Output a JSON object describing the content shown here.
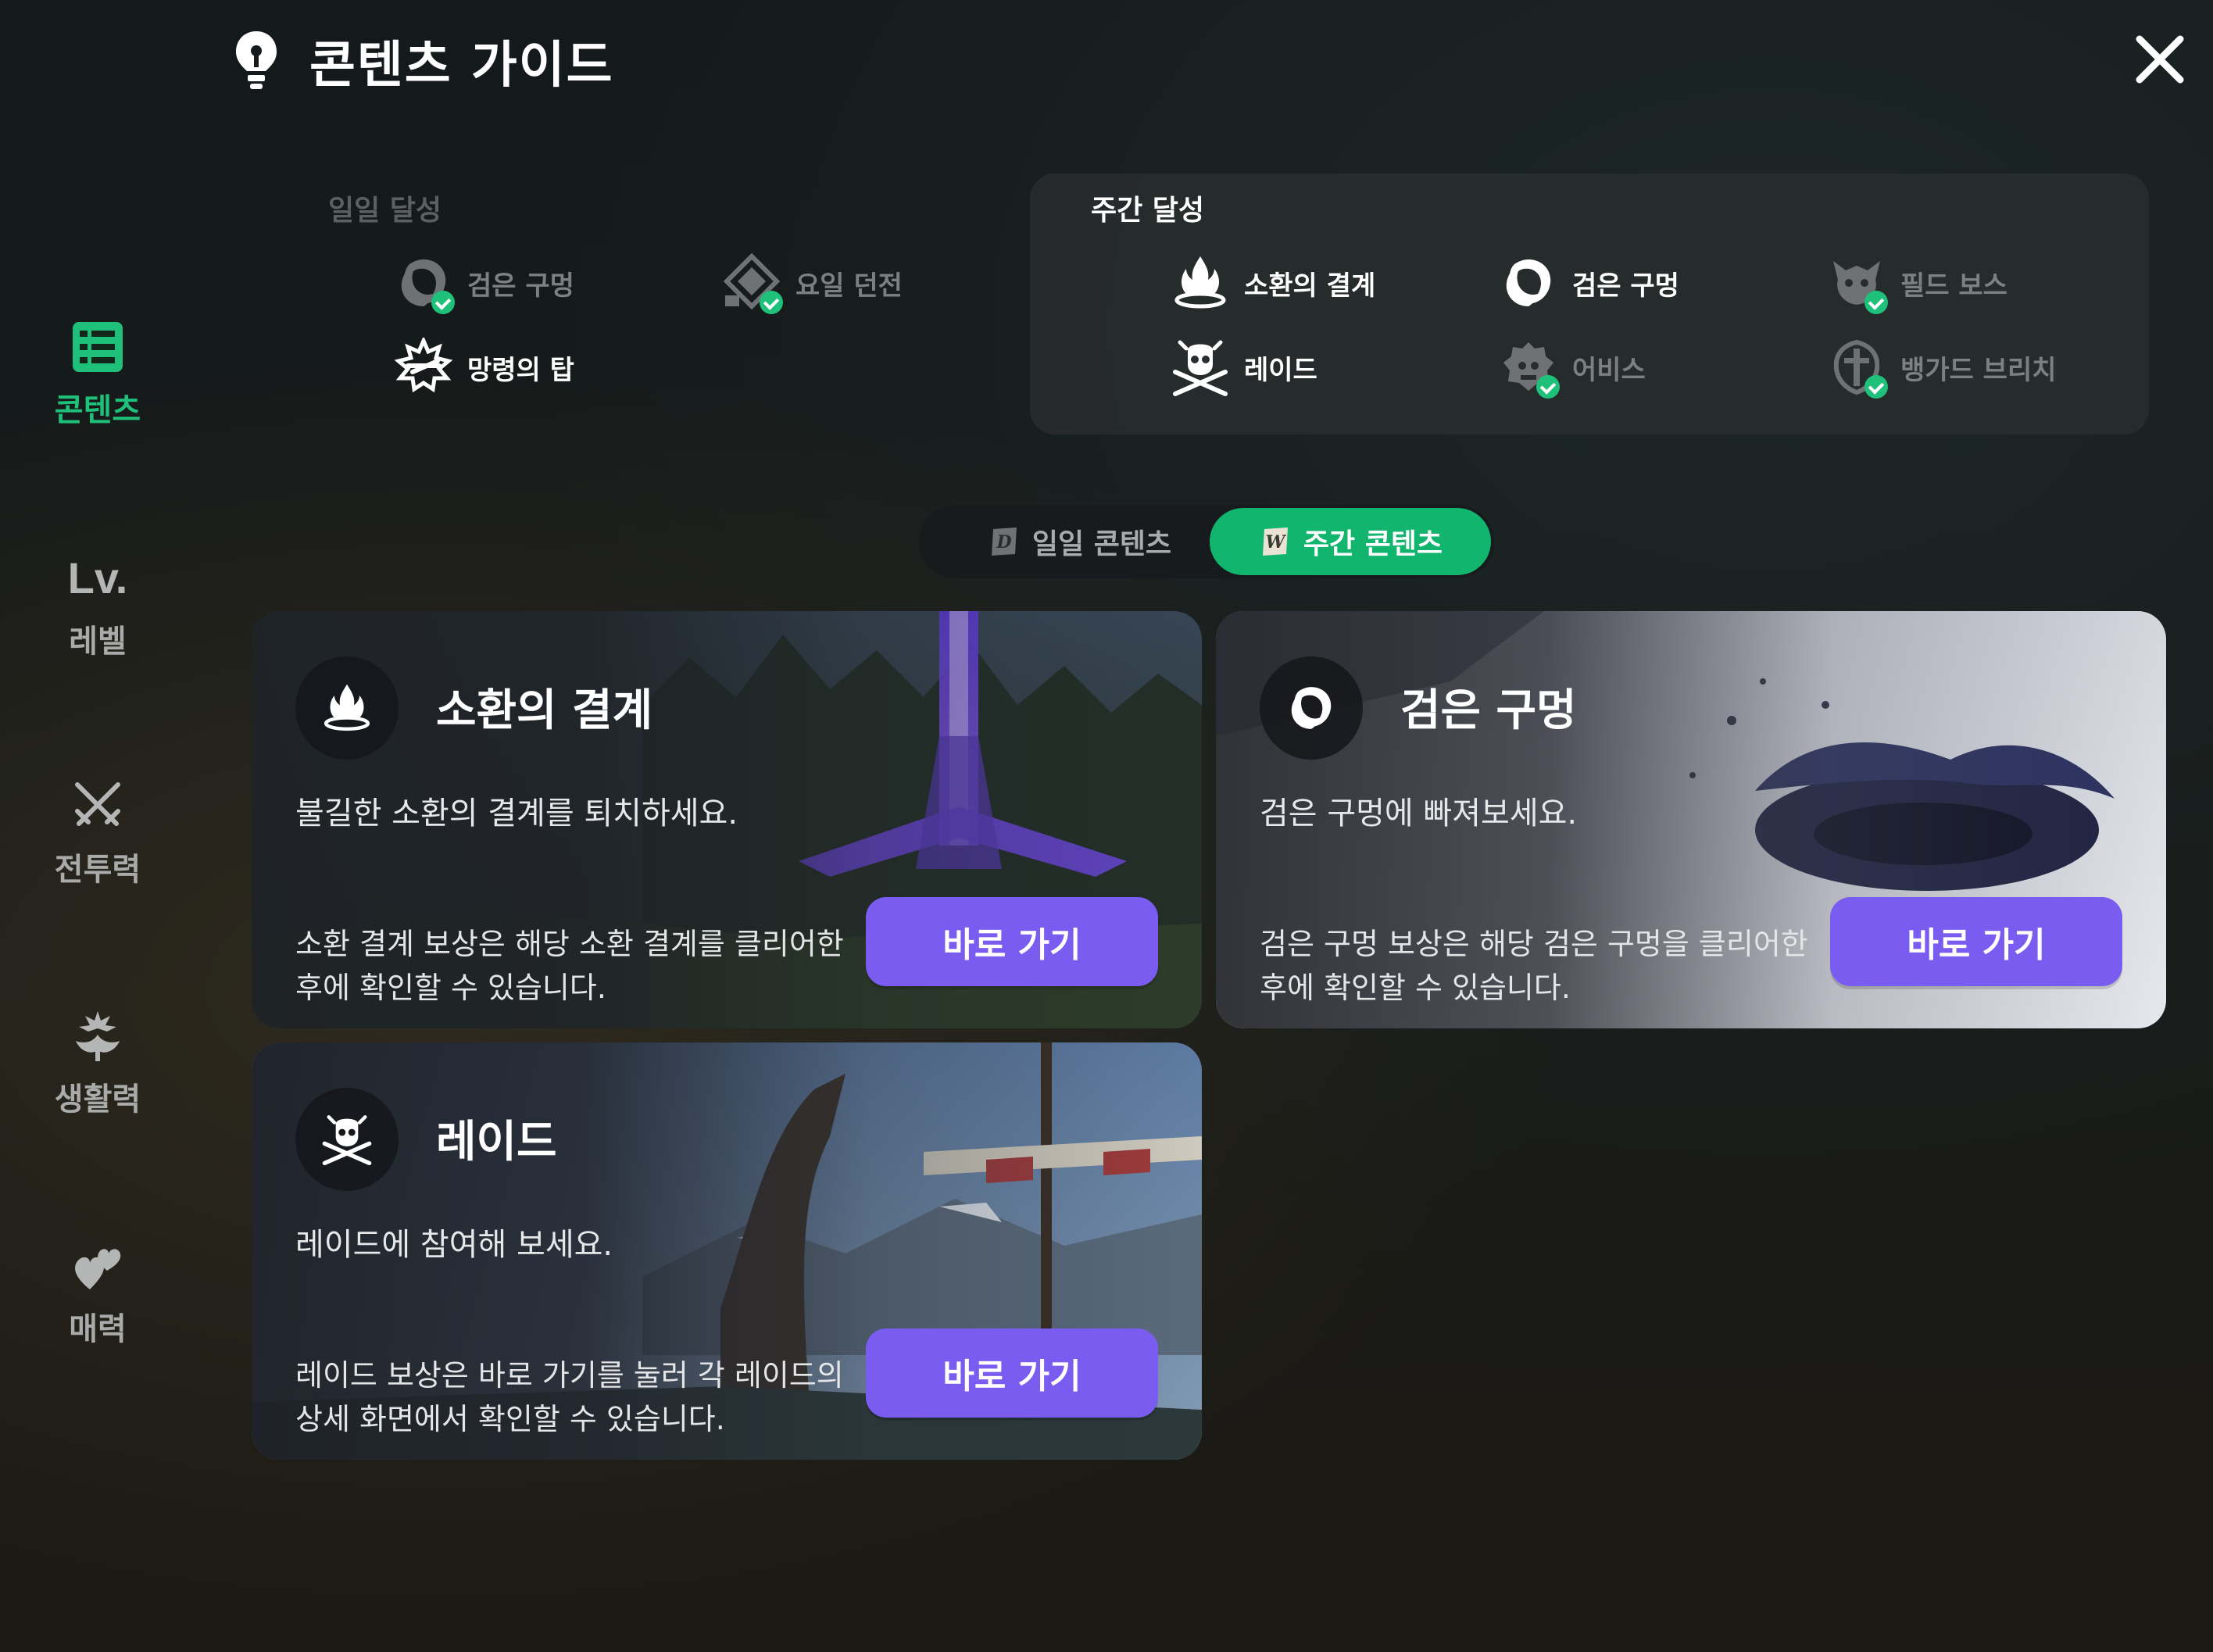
{
  "header": {
    "title": "콘텐츠 가이드",
    "icon": "lightbulb-icon",
    "close_icon": "close-icon"
  },
  "nav": {
    "items": [
      {
        "label": "콘텐츠",
        "icon": "checklist-icon",
        "active": true
      },
      {
        "label": "레벨",
        "icon_text": "Lv.",
        "active": false
      },
      {
        "label": "전투력",
        "icon": "crossed-swords-icon",
        "active": false
      },
      {
        "label": "생활력",
        "icon": "sprout-icon",
        "active": false
      },
      {
        "label": "매력",
        "icon": "hearts-icon",
        "active": false
      }
    ]
  },
  "daily_achievements": {
    "title": "일일 달성",
    "items": [
      {
        "label": "검은 구멍",
        "icon": "black-hole-icon",
        "completed": true
      },
      {
        "label": "요일 던전",
        "icon": "dungeon-icon",
        "completed": true
      },
      {
        "label": "망령의 탑",
        "icon": "tower-icon",
        "completed": false
      }
    ]
  },
  "weekly_achievements": {
    "title": "주간 달성",
    "items": [
      {
        "label": "소환의 결계",
        "icon": "summon-barrier-icon",
        "completed": false
      },
      {
        "label": "검은 구멍",
        "icon": "black-hole-icon",
        "completed": false
      },
      {
        "label": "필드 보스",
        "icon": "field-boss-icon",
        "completed": true
      },
      {
        "label": "레이드",
        "icon": "raid-skull-icon",
        "completed": false
      },
      {
        "label": "어비스",
        "icon": "abyss-icon",
        "completed": true
      },
      {
        "label": "뱅가드 브리치",
        "icon": "vanguard-icon",
        "completed": true
      }
    ]
  },
  "tabs": {
    "daily_label": "일일 콘텐츠",
    "weekly_label": "주간 콘텐츠",
    "daily_icon_letter": "D",
    "weekly_icon_letter": "W",
    "selected": "weekly"
  },
  "cards": [
    {
      "title": "소환의 결계",
      "icon": "summon-barrier-icon",
      "subtitle": "불길한 소환의 결계를 퇴치하세요.",
      "note_line1": "소환 결계 보상은 해당 소환 결계를 클리어한",
      "note_line2": "후에 확인할 수 있습니다.",
      "button": "바로 가기"
    },
    {
      "title": "검은 구멍",
      "icon": "black-hole-icon",
      "subtitle": "검은 구멍에 빠져보세요.",
      "note_line1": "검은 구멍 보상은 해당 검은 구멍을 클리어한",
      "note_line2": "후에 확인할 수 있습니다.",
      "button": "바로 가기"
    },
    {
      "title": "레이드",
      "icon": "raid-skull-icon",
      "subtitle": "레이드에 참여해 보세요.",
      "note_line1": "레이드 보상은 바로 가기를 눌러 각 레이드의",
      "note_line2": "상세 화면에서 확인할 수 있습니다.",
      "button": "바로 가기"
    }
  ],
  "colors": {
    "accent_green": "#1ec07a",
    "button_purple": "#7a5cf0",
    "panel_bg": "#282c2e"
  }
}
